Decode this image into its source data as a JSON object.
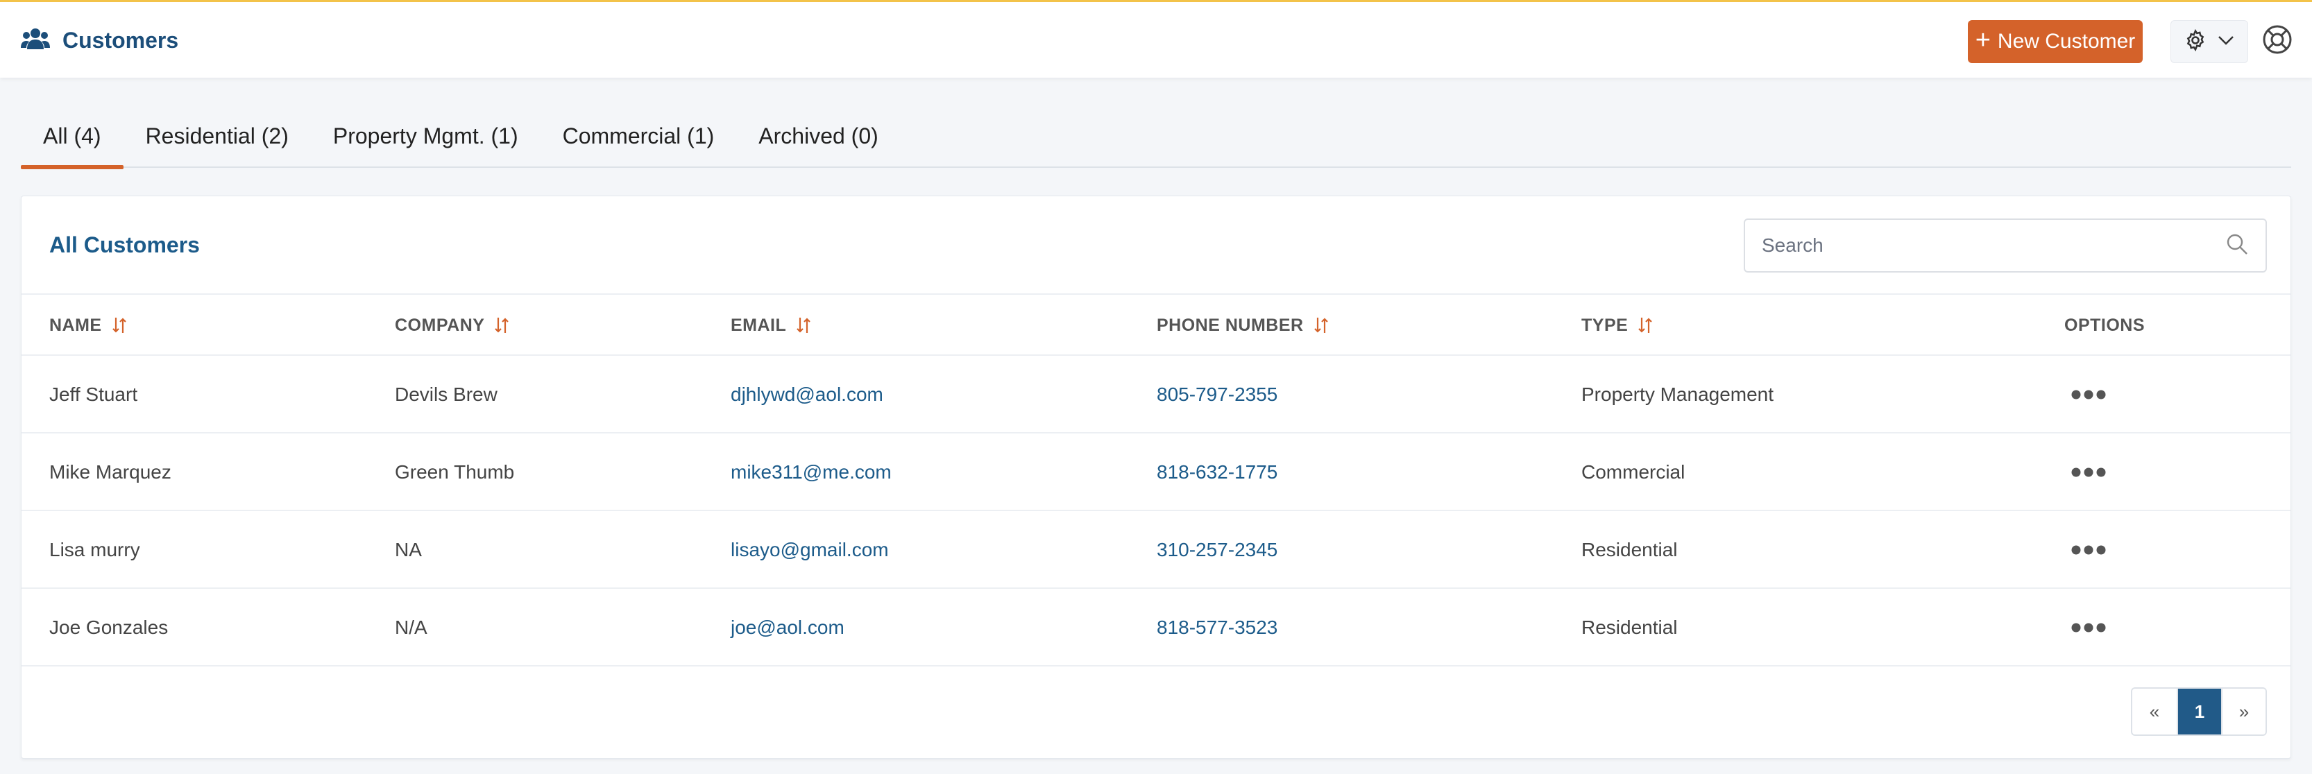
{
  "header": {
    "title": "Customers",
    "title_icon": "users-icon",
    "new_button_label": "New Customer",
    "settings_icon": "gear-icon",
    "help_icon": "lifebuoy-icon",
    "accent_color": "#d4622a",
    "brand_color": "#1c4e7a"
  },
  "tabs": [
    {
      "label": "All (4)",
      "active": true
    },
    {
      "label": "Residential (2)",
      "active": false
    },
    {
      "label": "Property Mgmt. (1)",
      "active": false
    },
    {
      "label": "Commercial (1)",
      "active": false
    },
    {
      "label": "Archived (0)",
      "active": false
    }
  ],
  "panel": {
    "title": "All Customers",
    "search_placeholder": "Search"
  },
  "table": {
    "columns": [
      "NAME",
      "COMPANY",
      "EMAIL",
      "PHONE NUMBER",
      "TYPE",
      "OPTIONS"
    ],
    "rows": [
      {
        "name": "Jeff Stuart",
        "company": "Devils Brew",
        "email": "djhlywd@aol.com",
        "phone": "805-797-2355",
        "type": "Property Management"
      },
      {
        "name": "Mike Marquez",
        "company": "Green Thumb",
        "email": "mike311@me.com",
        "phone": "818-632-1775",
        "type": "Commercial"
      },
      {
        "name": "Lisa murry",
        "company": "NA",
        "email": "lisayo@gmail.com",
        "phone": "310-257-2345",
        "type": "Residential"
      },
      {
        "name": "Joe Gonzales",
        "company": "N/A",
        "email": "joe@aol.com",
        "phone": "818-577-3523",
        "type": "Residential"
      }
    ]
  },
  "pagination": {
    "prev": "«",
    "current": "1",
    "next": "»"
  }
}
